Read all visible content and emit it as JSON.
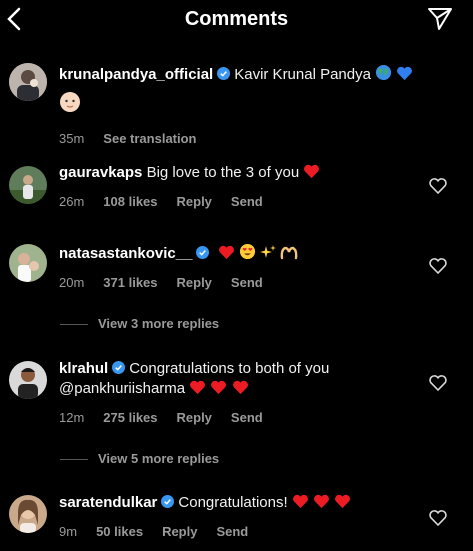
{
  "header": {
    "title": "Comments"
  },
  "comments": [
    {
      "user": "krunalpandya_official",
      "text": "Kavir Krunal Pandya",
      "time": "35m",
      "action1": "See translation"
    },
    {
      "user": "gauravkaps",
      "text": "Big love to the 3 of you",
      "time": "26m",
      "likes": "108 likes",
      "reply": "Reply",
      "send": "Send"
    },
    {
      "user": "natasastankovic__",
      "text": "",
      "time": "20m",
      "likes": "371 likes",
      "reply": "Reply",
      "send": "Send",
      "more_replies": "View 3 more replies"
    },
    {
      "user": "klrahul",
      "text": "Congratulations to both of you",
      "text2": "@pankhuriisharma",
      "time": "12m",
      "likes": "275 likes",
      "reply": "Reply",
      "send": "Send",
      "more_replies": "View 5 more replies"
    },
    {
      "user": "saratendulkar",
      "text": "Congratulations!",
      "time": "9m",
      "likes": "50 likes",
      "reply": "Reply",
      "send": "Send"
    }
  ],
  "colors": {
    "background": "#000000",
    "verified": "#3897f0",
    "heart": "#ed1c24",
    "meta": "#9a9a9a"
  }
}
